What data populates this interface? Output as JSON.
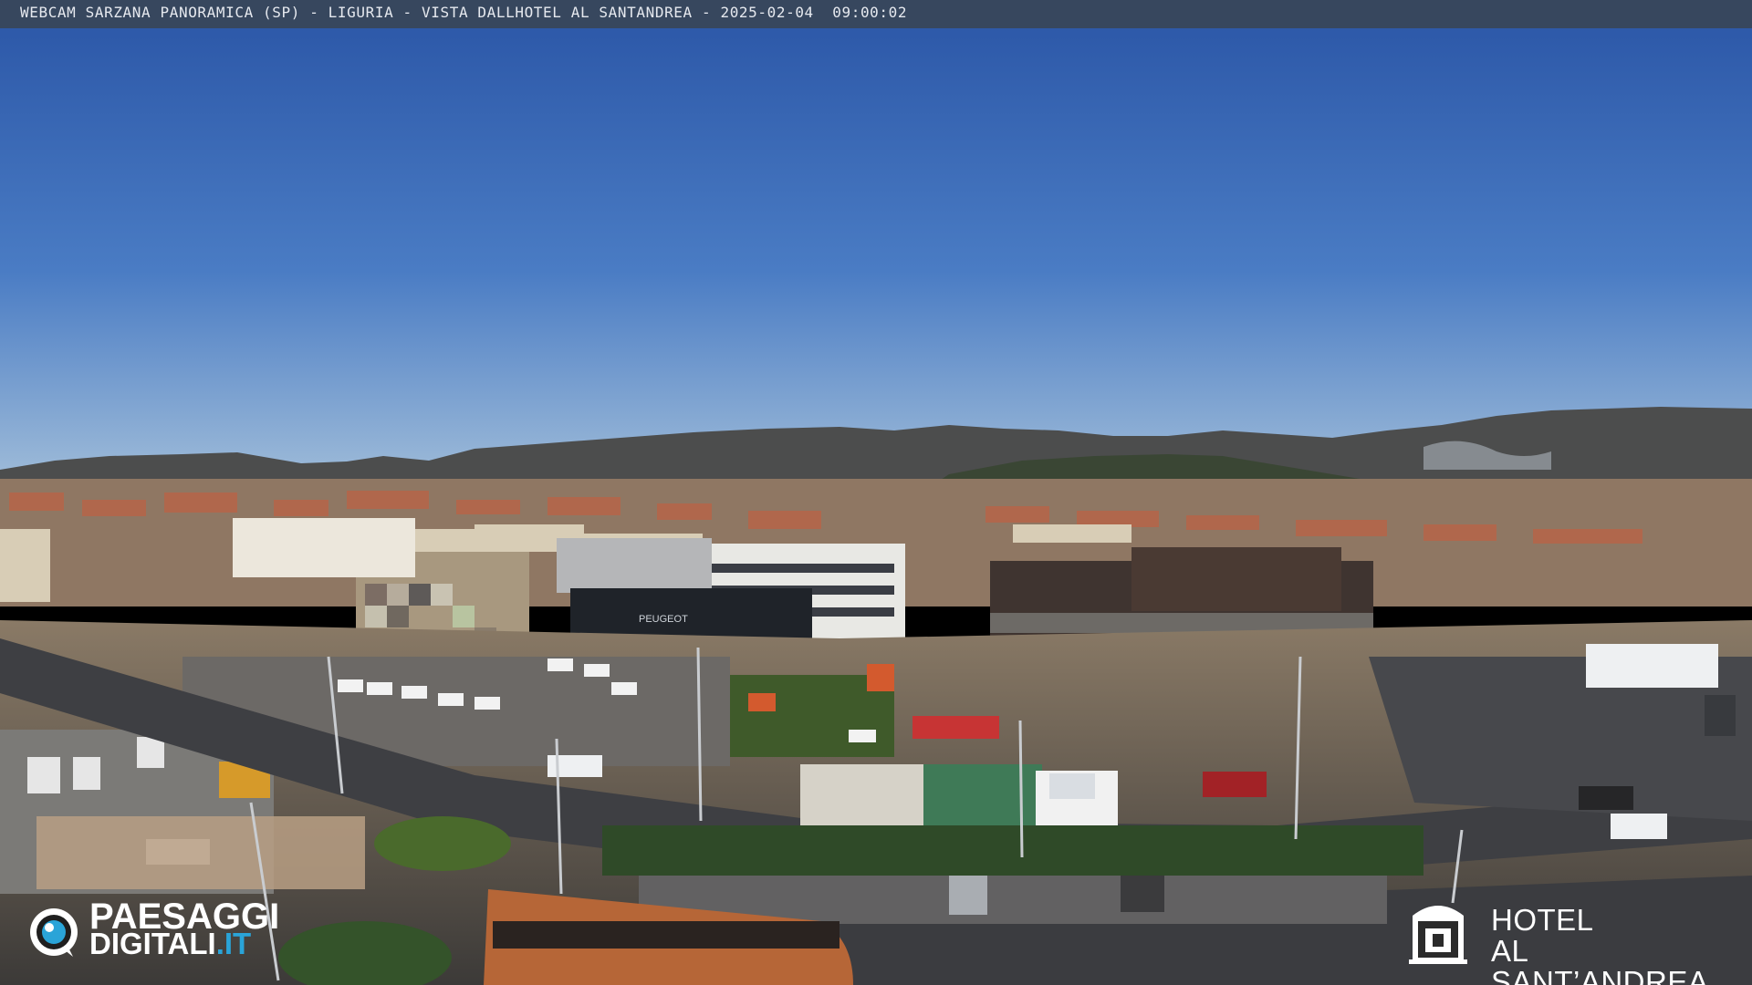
{
  "overlay": {
    "caption": "WEBCAM SARZANA PANORAMICA (SP) - LIGURIA - VISTA DALLHOTEL AL SANTANDREA - 2025-02-04  09:00:02"
  },
  "logo_left": {
    "line1": "PAESAGGI",
    "line2": "DIGITALI",
    "line2_suffix": ".IT"
  },
  "logo_right": {
    "line1": "HOTEL",
    "line2": "AL SANT’ANDREA"
  },
  "scene": {
    "signs": {
      "dealer": "PEUGEOT"
    }
  },
  "colors": {
    "sky_top": "#2a56a8",
    "sky_horizon": "#9cbad8",
    "hills": "#4a4a48",
    "overlay_bar": "#37475e",
    "brand_accent": "#2aa4d8"
  }
}
